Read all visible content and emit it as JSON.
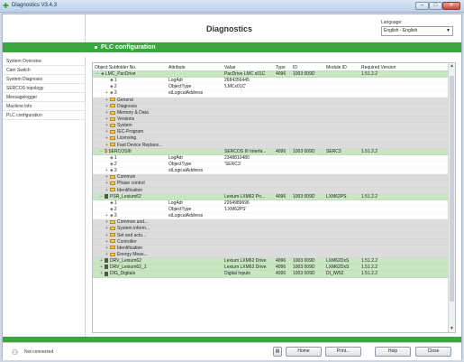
{
  "window": {
    "title": "Diagnostics V3.4.3",
    "controls": [
      "–",
      "□",
      "✕"
    ]
  },
  "header": {
    "title": "Diagnostics",
    "language_label": "Language:",
    "language_value": "English - English"
  },
  "section": {
    "title": "PLC configuration"
  },
  "sidebar": {
    "items": [
      {
        "label": "System Overview"
      },
      {
        "label": "Cam Switch"
      },
      {
        "label": "System Diagnosis"
      },
      {
        "label": "SERCOS topology"
      },
      {
        "label": "Messagelogger"
      },
      {
        "label": "Machine info"
      },
      {
        "label": "PLC configuration"
      }
    ]
  },
  "table": {
    "columns": [
      "Object Subfolder No.",
      "Attribute",
      "Value",
      "Type",
      "ID",
      "Module ID",
      "Required Version"
    ],
    "rows": [
      {
        "exp": "−",
        "icon": "pin",
        "name": "LMC_PacDrive",
        "attr": "",
        "value": "PacDrive LMC x01C",
        "type": "4096",
        "id": "1003 009D",
        "mid": "",
        "ver": "1.51.2.2",
        "hl": true
      },
      {
        "exp": "",
        "icon": "pin",
        "name": "1",
        "attr": "LogAdr",
        "value": "2684356445",
        "type": "",
        "id": "",
        "mid": "",
        "ver": ""
      },
      {
        "exp": "",
        "icon": "pin",
        "name": "2",
        "attr": "ObjectType",
        "value": "'LMCx01C'",
        "type": "",
        "id": "",
        "mid": "",
        "ver": ""
      },
      {
        "exp": "+",
        "icon": "pin",
        "name": "3",
        "attr": "stLogicalAddress",
        "value": "",
        "type": "",
        "id": "",
        "mid": "",
        "ver": ""
      },
      {
        "exp": "+",
        "icon": "folder",
        "name": "General",
        "attr": "",
        "value": "",
        "type": "",
        "id": "",
        "mid": "",
        "ver": "",
        "gray": true
      },
      {
        "exp": "+",
        "icon": "folder",
        "name": "Diagnosis",
        "attr": "",
        "value": "",
        "type": "",
        "id": "",
        "mid": "",
        "ver": "",
        "gray": true
      },
      {
        "exp": "+",
        "icon": "folder",
        "name": "Memory & Data",
        "attr": "",
        "value": "",
        "type": "",
        "id": "",
        "mid": "",
        "ver": "",
        "gray": true
      },
      {
        "exp": "+",
        "icon": "folder",
        "name": "Versions",
        "attr": "",
        "value": "",
        "type": "",
        "id": "",
        "mid": "",
        "ver": "",
        "gray": true
      },
      {
        "exp": "+",
        "icon": "folder",
        "name": "System",
        "attr": "",
        "value": "",
        "type": "",
        "id": "",
        "mid": "",
        "ver": "",
        "gray": true
      },
      {
        "exp": "+",
        "icon": "folder",
        "name": "IEC-Program",
        "attr": "",
        "value": "",
        "type": "",
        "id": "",
        "mid": "",
        "ver": "",
        "gray": true
      },
      {
        "exp": "+",
        "icon": "folder",
        "name": "Licensing",
        "attr": "",
        "value": "",
        "type": "",
        "id": "",
        "mid": "",
        "ver": "",
        "gray": true
      },
      {
        "exp": "+",
        "icon": "folder",
        "name": "Fast Device Replace...",
        "attr": "",
        "value": "",
        "type": "",
        "id": "",
        "mid": "",
        "ver": "",
        "gray": true
      },
      {
        "exp": "−",
        "icon": "red",
        "name": "SERCOSIII",
        "attr": "",
        "value": "SERCOS III Interfa...",
        "type": "4096",
        "id": "1003 009D",
        "mid": "SERC3",
        "ver": "1.51.2.2",
        "hl": true
      },
      {
        "exp": "",
        "icon": "pin",
        "name": "1",
        "attr": "LogAdr",
        "value": "2348810480",
        "type": "",
        "id": "",
        "mid": "",
        "ver": ""
      },
      {
        "exp": "",
        "icon": "pin",
        "name": "2",
        "attr": "ObjectType",
        "value": "'SERC3'",
        "type": "",
        "id": "",
        "mid": "",
        "ver": ""
      },
      {
        "exp": "+",
        "icon": "pin",
        "name": "3",
        "attr": "stLogicalAddress",
        "value": "",
        "type": "",
        "id": "",
        "mid": "",
        "ver": ""
      },
      {
        "exp": "+",
        "icon": "folder",
        "name": "Common",
        "attr": "",
        "value": "",
        "type": "",
        "id": "",
        "mid": "",
        "ver": "",
        "gray": true
      },
      {
        "exp": "+",
        "icon": "folder",
        "name": "Phase control",
        "attr": "",
        "value": "",
        "type": "",
        "id": "",
        "mid": "",
        "ver": "",
        "gray": true
      },
      {
        "exp": "+",
        "icon": "folder",
        "name": "Identification",
        "attr": "",
        "value": "",
        "type": "",
        "id": "",
        "mid": "",
        "ver": "",
        "gray": true
      },
      {
        "exp": "−",
        "icon": "drv",
        "name": "PSR_Lexium62",
        "attr": "",
        "value": "Lexium LXM62 Po...",
        "type": "4096",
        "id": "1003 009D",
        "mid": "LXM62PS",
        "ver": "1.51.2.2",
        "hl": true
      },
      {
        "exp": "",
        "icon": "pin",
        "name": "1",
        "attr": "LogAdr",
        "value": "2264989696",
        "type": "",
        "id": "",
        "mid": "",
        "ver": ""
      },
      {
        "exp": "",
        "icon": "pin",
        "name": "2",
        "attr": "ObjectType",
        "value": "'LXM62PS'",
        "type": "",
        "id": "",
        "mid": "",
        "ver": ""
      },
      {
        "exp": "+",
        "icon": "pin",
        "name": "3",
        "attr": "stLogicalAddress",
        "value": "",
        "type": "",
        "id": "",
        "mid": "",
        "ver": ""
      },
      {
        "exp": "+",
        "icon": "folder",
        "name": "Common and...",
        "attr": "",
        "value": "",
        "type": "",
        "id": "",
        "mid": "",
        "ver": "",
        "gray": true
      },
      {
        "exp": "+",
        "icon": "folder",
        "name": "System inform...",
        "attr": "",
        "value": "",
        "type": "",
        "id": "",
        "mid": "",
        "ver": "",
        "gray": true
      },
      {
        "exp": "+",
        "icon": "folder",
        "name": "Set and actu...",
        "attr": "",
        "value": "",
        "type": "",
        "id": "",
        "mid": "",
        "ver": "",
        "gray": true
      },
      {
        "exp": "+",
        "icon": "folder",
        "name": "Controller",
        "attr": "",
        "value": "",
        "type": "",
        "id": "",
        "mid": "",
        "ver": "",
        "gray": true
      },
      {
        "exp": "+",
        "icon": "folder",
        "name": "Identification",
        "attr": "",
        "value": "",
        "type": "",
        "id": "",
        "mid": "",
        "ver": "",
        "gray": true
      },
      {
        "exp": "+",
        "icon": "folder",
        "name": "Energy Meas...",
        "attr": "",
        "value": "",
        "type": "",
        "id": "",
        "mid": "",
        "ver": "",
        "gray": true
      },
      {
        "exp": "+",
        "icon": "drv",
        "name": "DRV_Lexium62",
        "attr": "",
        "value": "Lexium LXM62 Drive",
        "type": "4096",
        "id": "1003 009D",
        "mid": "LXM62DxS",
        "ver": "1.51.2.2",
        "hl": true
      },
      {
        "exp": "+",
        "icon": "drv",
        "name": "DRV_Lexium62_1",
        "attr": "",
        "value": "Lexium LXM62 Drive",
        "type": "4096",
        "id": "1003 009D",
        "mid": "LXM62DxS",
        "ver": "1.51.2.2",
        "hl": true
      },
      {
        "exp": "+",
        "icon": "drv",
        "name": "DIG_Digitals",
        "attr": "",
        "value": "Digital Inputs",
        "type": "4096",
        "id": "1003 009D",
        "mid": "DI_IW52",
        "ver": "1.51.2.2",
        "hl": true
      }
    ]
  },
  "footer": {
    "status": "Not connected",
    "buttons": {
      "small": "▤",
      "home": "Home",
      "print": "Print...",
      "help": "Help",
      "close": "Close"
    }
  }
}
